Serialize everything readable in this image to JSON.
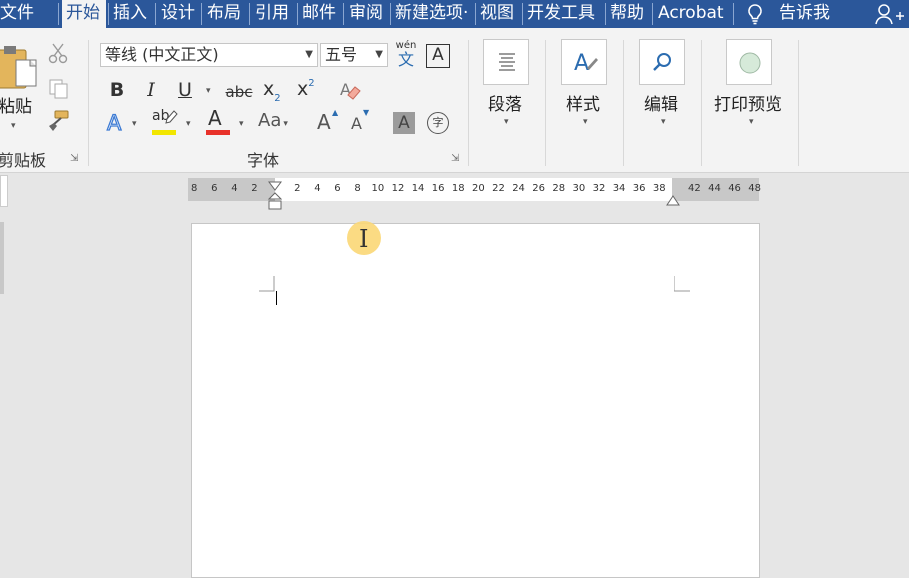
{
  "tabs": [
    {
      "label": "文件",
      "selected": false
    },
    {
      "label": "开始",
      "selected": true
    },
    {
      "label": "插入",
      "selected": false
    },
    {
      "label": "设计",
      "selected": false
    },
    {
      "label": "布局",
      "selected": false
    },
    {
      "label": "引用",
      "selected": false
    },
    {
      "label": "邮件",
      "selected": false
    },
    {
      "label": "审阅",
      "selected": false
    },
    {
      "label": "新建选项·",
      "selected": false
    },
    {
      "label": "视图",
      "selected": false
    },
    {
      "label": "开发工具",
      "selected": false
    },
    {
      "label": "帮助",
      "selected": false
    },
    {
      "label": "Acrobat",
      "selected": false
    }
  ],
  "tell_me": {
    "label": "告诉我",
    "icon": "lightbulb-icon"
  },
  "share": {
    "icon": "add-person-icon"
  },
  "clipboard": {
    "paste_label": "粘贴",
    "group_label": "剪贴板",
    "icons": [
      "clipboard-icon",
      "cut-icon",
      "copy-icon",
      "format-painter-icon"
    ]
  },
  "font": {
    "font_name": "等线 (中文正文)",
    "font_size": "五号",
    "phonetic_top": "wén",
    "phonetic_bottom": "文",
    "char_border": "A",
    "bold": "B",
    "italic": "I",
    "underline": "U",
    "strikethrough": "abc",
    "subscript_base": "x",
    "subscript_mark": "2",
    "superscript_base": "x",
    "superscript_mark": "2",
    "highlight_text": "ab",
    "font_color_text": "A",
    "change_case": "Aa",
    "grow": "A",
    "shrink": "A",
    "char_shading": "A",
    "enclose": "字",
    "group_label": "字体",
    "highlight_color": "#f2e600",
    "font_color": "#e8312a"
  },
  "paragraph": {
    "label": "段落",
    "icon": "paragraph-icon"
  },
  "styles": {
    "label": "样式",
    "icon": "styles-icon"
  },
  "editing": {
    "label": "编辑",
    "icon": "search-icon"
  },
  "print_preview": {
    "label": "打印预览",
    "icon": "circle-icon"
  },
  "ruler": {
    "left_numbers": [
      "8",
      "6",
      "4",
      "2"
    ],
    "right_numbers": [
      "2",
      "4",
      "6",
      "8",
      "10",
      "12",
      "14",
      "16",
      "18",
      "20",
      "22",
      "24",
      "26",
      "28",
      "30",
      "32",
      "34",
      "36",
      "38"
    ],
    "far_numbers": [
      "42",
      "44",
      "46",
      "48"
    ]
  },
  "colors": {
    "tab_bar": "#2b579a",
    "ribbon": "#f3f3f3",
    "cursor_highlight": "#fbd776"
  }
}
